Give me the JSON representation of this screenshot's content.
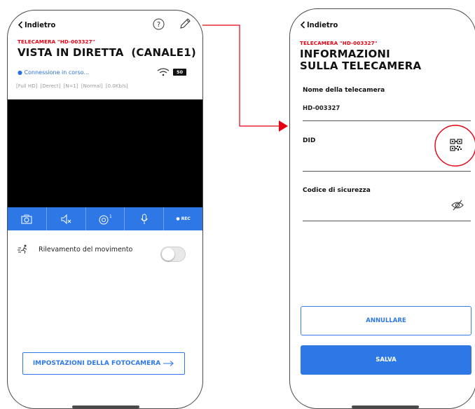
{
  "live_screen": {
    "back_label": "Indietro",
    "camera_subtitle": "TELECAMERA \"HD-003327\"",
    "title": "VISTA IN DIRETTA  (CANALE1)",
    "connection_status": "● Connessione in corso...",
    "battery_label": "50",
    "stream_chips": [
      "Full HD",
      "Derect",
      "N=1",
      "Normal",
      "0.0Kb/s"
    ],
    "toolbar": {
      "rec_label": "● REC",
      "camera_switch_badge": "1"
    },
    "motion_detection_label": "Rilevamento del movimento",
    "motion_detection_enabled": false,
    "settings_button_label": "IMPOSTAZIONI DELLA FOTOCAMERA"
  },
  "info_screen": {
    "back_label": "Indietro",
    "camera_subtitle": "TELECAMERA \"HD-003327\"",
    "title_line1": "INFORMAZIONI",
    "title_line2": "SULLA TELECAMERA",
    "camera_name_label": "Nome della telecamera",
    "camera_name_value": "HD-003327",
    "did_label": "DID",
    "did_value": "",
    "security_code_label": "Codice di sicurezza",
    "security_code_value": "",
    "cancel_label": "ANNULLARE",
    "save_label": "SALVA"
  },
  "colors": {
    "accent_blue": "#2e78e6",
    "highlight_red": "#e60012"
  }
}
